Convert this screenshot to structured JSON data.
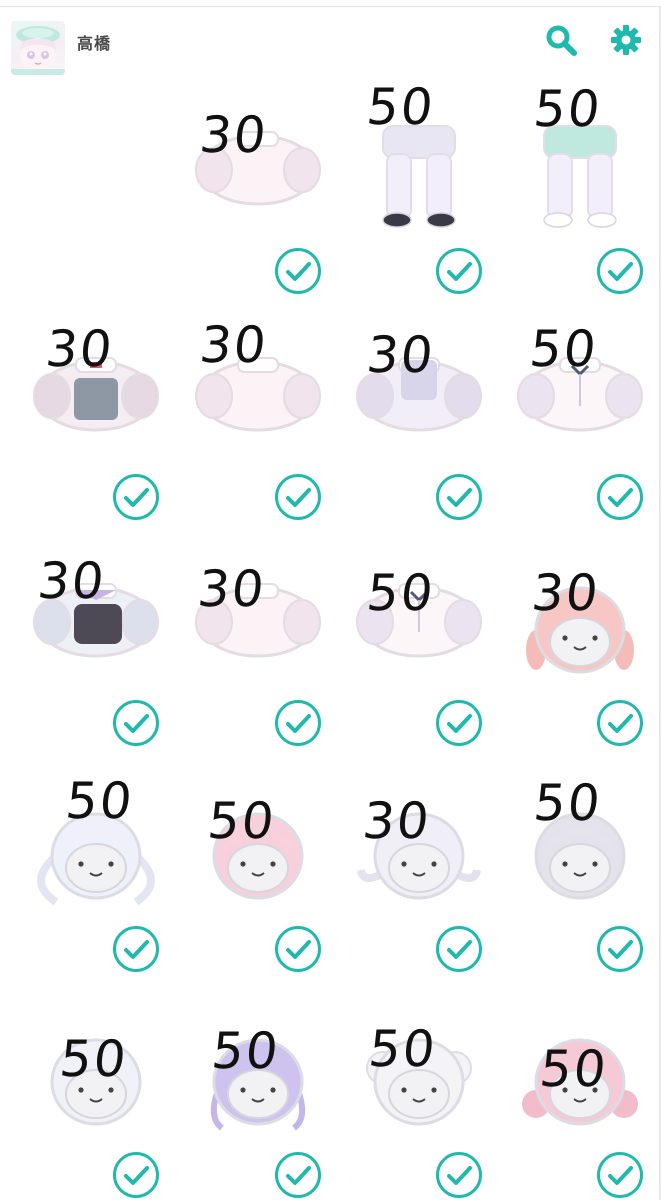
{
  "header": {
    "username": "高橋",
    "avatar_icon": "avatar-image",
    "search_icon": "search-icon",
    "settings_icon": "gear-icon"
  },
  "colors": {
    "accent": "#1fb9ad",
    "handwriting": "#111111",
    "divider": "#e6e6e6"
  },
  "items": [
    {
      "price": "",
      "kind": "empty"
    },
    {
      "price": "30",
      "kind": "top"
    },
    {
      "price": "50",
      "kind": "legs-dark"
    },
    {
      "price": "50",
      "kind": "legs-mint"
    },
    {
      "price": "30",
      "kind": "overalls"
    },
    {
      "price": "30",
      "kind": "top"
    },
    {
      "price": "30",
      "kind": "fur-top"
    },
    {
      "price": "50",
      "kind": "blouse"
    },
    {
      "price": "30",
      "kind": "blouse-dark"
    },
    {
      "price": "30",
      "kind": "top"
    },
    {
      "price": "50",
      "kind": "blouse"
    },
    {
      "price": "30",
      "kind": "hair-pink-braids"
    },
    {
      "price": "50",
      "kind": "hair-white-twin"
    },
    {
      "price": "50",
      "kind": "hair-pink-bob"
    },
    {
      "price": "30",
      "kind": "hair-twin-tails"
    },
    {
      "price": "50",
      "kind": "hair-grey-bob"
    },
    {
      "price": "50",
      "kind": "hair-white-bob"
    },
    {
      "price": "50",
      "kind": "hair-lavender"
    },
    {
      "price": "50",
      "kind": "hair-white-fluffy"
    },
    {
      "price": "50",
      "kind": "hair-pink-curls"
    }
  ]
}
